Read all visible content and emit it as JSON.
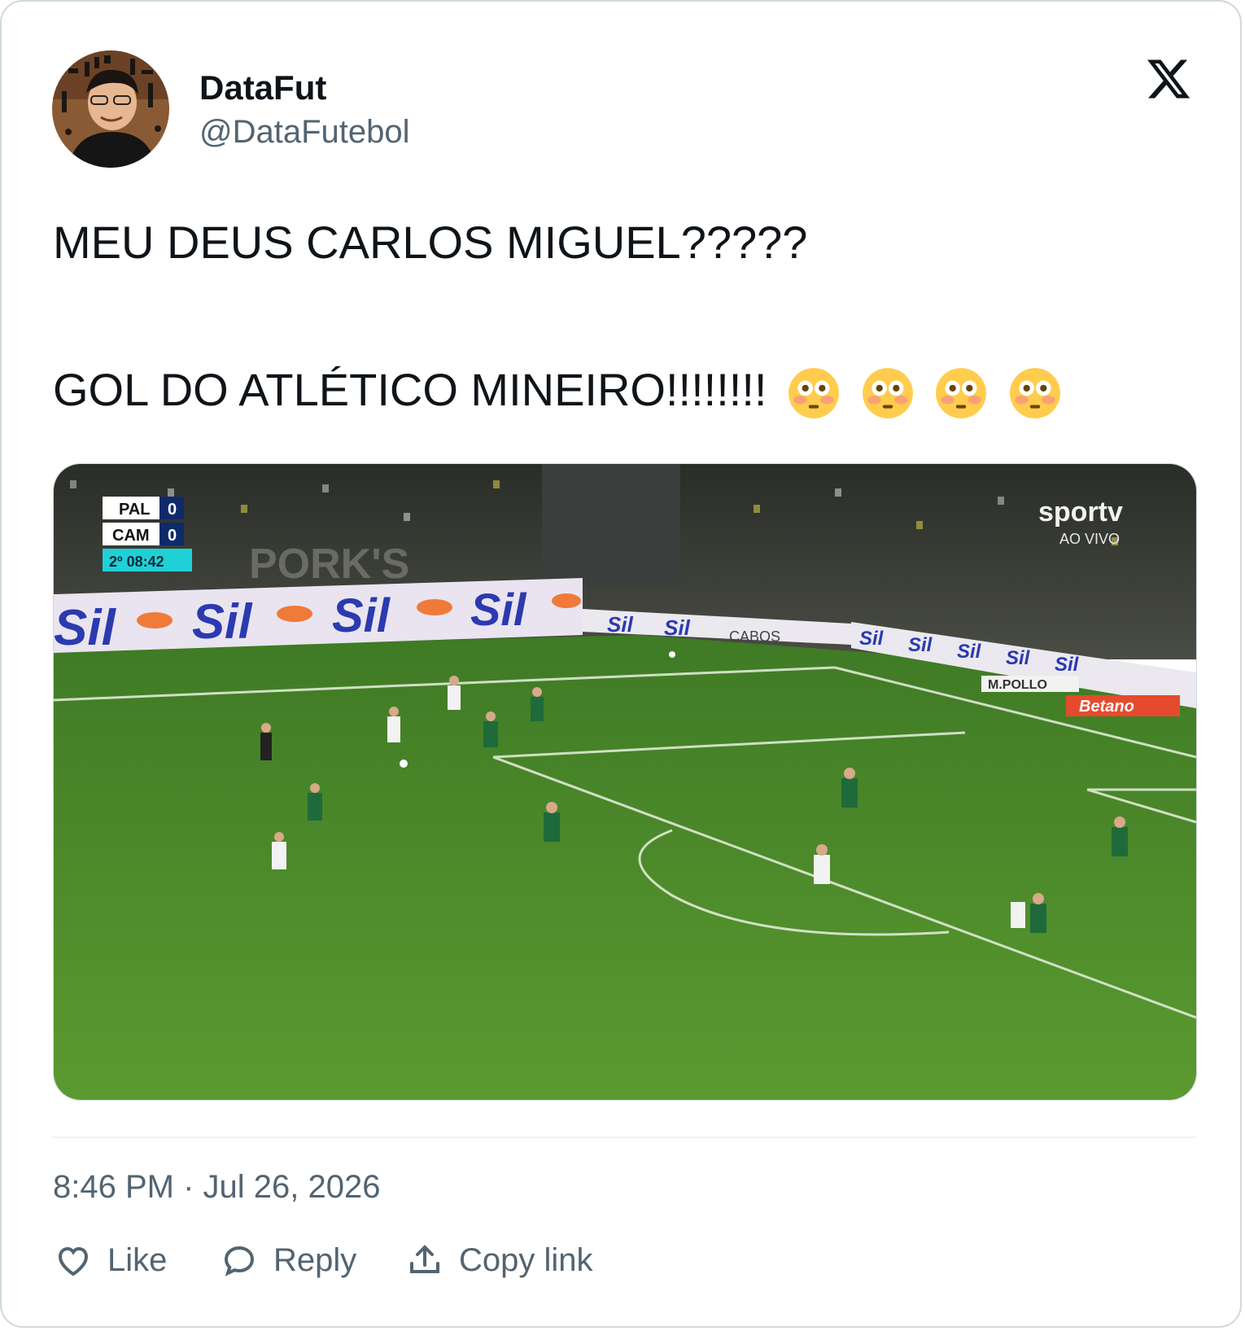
{
  "author": {
    "name": "DataFut",
    "handle": "@DataFutebol"
  },
  "tweet": {
    "line1": "MEU DEUS CARLOS MIGUEL?????",
    "line2": "GOL DO ATLÉTICO MINEIRO!!!!!!!!",
    "emoji_names": [
      "flushed-face-icon",
      "flushed-face-icon",
      "flushed-face-icon",
      "flushed-face-icon"
    ]
  },
  "media": {
    "scoreboard": {
      "team1": "PAL",
      "score1": "0",
      "team2": "CAM",
      "score2": "0",
      "clock": "2º 08:42"
    },
    "broadcaster": "sportv",
    "broadcaster_status": "AO VIVO",
    "ads": [
      "Sil",
      "Sil",
      "Sil",
      "Sil",
      "CABOS",
      "M.POLLO",
      "Betano"
    ]
  },
  "meta": {
    "timestamp": "8:46 PM · Jul 26, 2026"
  },
  "actions": {
    "like": "Like",
    "reply": "Reply",
    "copy_link": "Copy link"
  },
  "colors": {
    "text": "#0f1419",
    "secondary": "#536471",
    "border": "#cfd9de",
    "pitch": "#4f8a2c"
  }
}
